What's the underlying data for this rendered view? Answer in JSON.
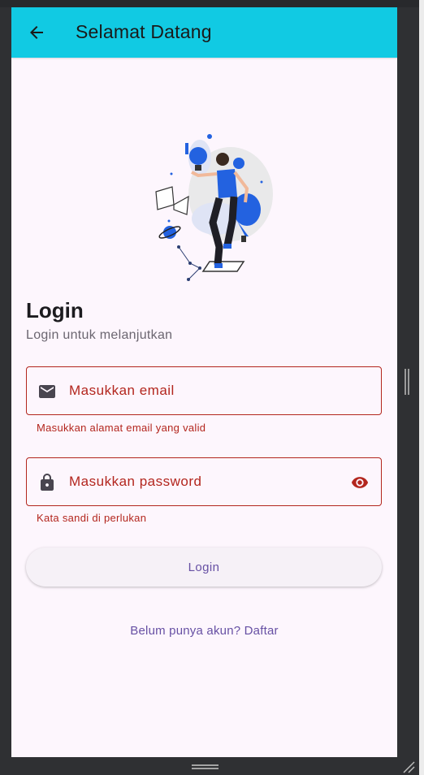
{
  "appbar": {
    "title": "Selamat Datang",
    "back_icon": "arrow-back-icon"
  },
  "header": {
    "title": "Login",
    "subtitle": "Login untuk melanjutkan"
  },
  "email": {
    "placeholder": "Masukkan email",
    "error": "Masukkan alamat email yang valid",
    "icon": "email-icon"
  },
  "password": {
    "placeholder": "Masukkan password",
    "error": "Kata sandi di perlukan",
    "icon": "lock-icon",
    "toggle_icon": "eye-icon"
  },
  "actions": {
    "login_label": "Login",
    "register_text": "Belum punya akun? Daftar"
  },
  "colors": {
    "appbar": "#11cae3",
    "error": "#b3261e",
    "primary": "#6750a4",
    "background": "#fdf6fd"
  }
}
